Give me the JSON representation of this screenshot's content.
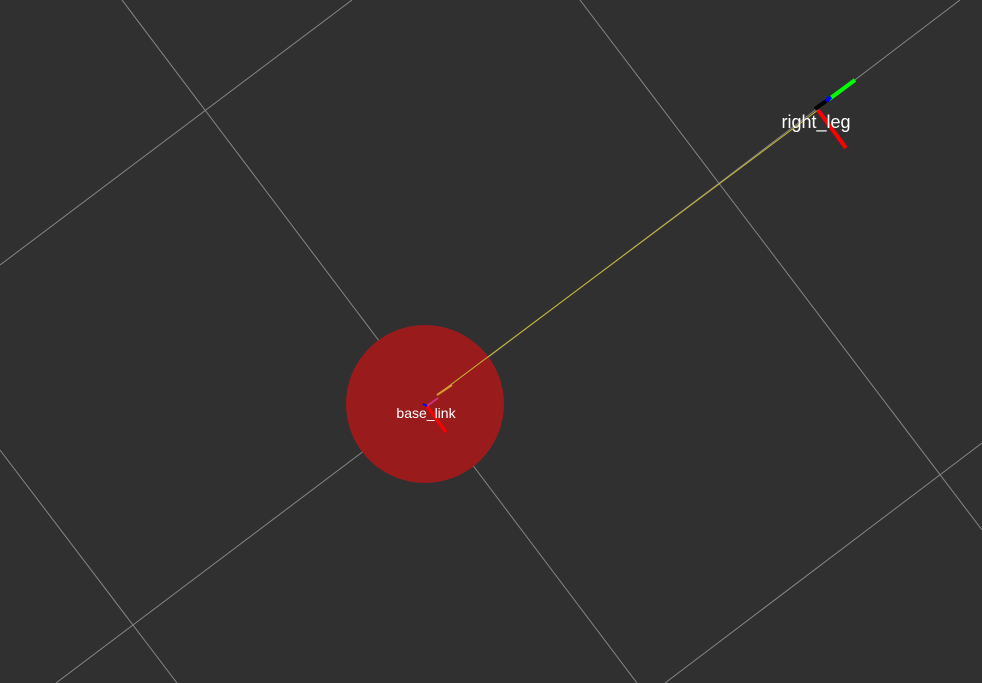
{
  "viewport": {
    "background": "#303030",
    "grid_color": "#a0a0a4"
  },
  "frames": {
    "base_link": {
      "label": "base_link",
      "marker_color": "#9a1b1c"
    },
    "right_leg": {
      "label": "right_leg"
    }
  },
  "tf_link": {
    "color": "#c8b432"
  },
  "axes_colors": {
    "x": "#ff0000",
    "y": "#00ff00",
    "z": "#0000ff"
  }
}
